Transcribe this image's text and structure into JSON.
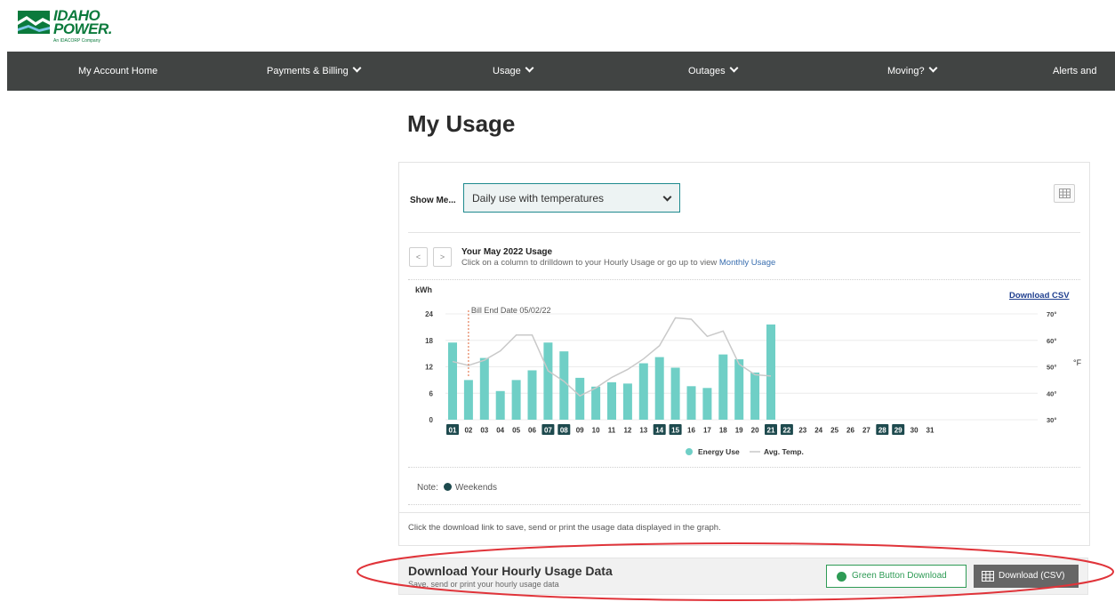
{
  "brand": {
    "name_line1": "IDAHO",
    "name_line2": "POWER.",
    "tagline": "An IDACORP Company"
  },
  "nav": [
    {
      "label": "My Account Home",
      "dropdown": false
    },
    {
      "label": "Payments & Billing",
      "dropdown": true
    },
    {
      "label": "Usage",
      "dropdown": true
    },
    {
      "label": "Outages",
      "dropdown": true
    },
    {
      "label": "Moving?",
      "dropdown": true
    },
    {
      "label": "Alerts and",
      "dropdown": false
    }
  ],
  "page": {
    "title": "My Usage"
  },
  "controls": {
    "show_me_label": "Show Me...",
    "selected_view": "Daily use with temperatures",
    "prev_label": "<",
    "next_label": ">"
  },
  "chart_header": {
    "title": "Your May 2022 Usage",
    "subtitle_prefix": "Click on a column to drilldown to your Hourly Usage or go up to view ",
    "subtitle_link": "Monthly Usage",
    "download_csv": "Download CSV"
  },
  "chart_data": {
    "type": "bar",
    "ylabel": "kWh",
    "y2label": "°F",
    "ylim": [
      0,
      24
    ],
    "y2lim": [
      30,
      70
    ],
    "yticks": [
      "0",
      "6",
      "12",
      "18",
      "24"
    ],
    "y2ticks": [
      "30°",
      "40°",
      "50°",
      "60°",
      "70°"
    ],
    "categories": [
      "01",
      "02",
      "03",
      "04",
      "05",
      "06",
      "07",
      "08",
      "09",
      "10",
      "11",
      "12",
      "13",
      "14",
      "15",
      "16",
      "17",
      "18",
      "19",
      "20",
      "21",
      "22",
      "23",
      "24",
      "25",
      "26",
      "27",
      "28",
      "29",
      "30",
      "31"
    ],
    "weekend_days": [
      "01",
      "07",
      "08",
      "14",
      "15",
      "21",
      "22",
      "28",
      "29"
    ],
    "series": [
      {
        "name": "Energy Use",
        "type": "bar",
        "color": "#6fcfc6",
        "values": [
          17.5,
          9,
          14,
          6.5,
          9,
          11.2,
          17.5,
          15.5,
          9.5,
          7.5,
          8.5,
          8.2,
          12.8,
          14.2,
          11.8,
          7.6,
          7.2,
          14.8,
          13.7,
          10.7,
          21.6,
          null,
          null,
          null,
          null,
          null,
          null,
          null,
          null,
          null,
          null
        ]
      },
      {
        "name": "Avg. Temp.",
        "type": "line",
        "color": "#c9c9c9",
        "values": [
          52,
          50.5,
          52.5,
          56,
          62,
          62,
          48.5,
          44.5,
          39,
          42,
          46,
          49,
          53,
          58,
          68.5,
          68,
          61.5,
          63.5,
          51,
          47,
          46.5,
          null,
          null,
          null,
          null,
          null,
          null,
          null,
          null,
          null,
          null
        ]
      }
    ],
    "annotation": {
      "label": "Bill End Date 05/02/22",
      "category": "02"
    },
    "legend": [
      "Energy Use",
      "Avg. Temp."
    ],
    "legend_position": "bottom"
  },
  "note": {
    "label": "Note:",
    "text": "Weekends"
  },
  "info_text": "Click the download link to save, send or print the usage data displayed in the graph.",
  "download": {
    "title": "Download Your Hourly Usage Data",
    "subtitle": "Save, send or print your hourly usage data",
    "green_button": "Green Button Download",
    "csv_button": "Download (CSV)"
  },
  "colors": {
    "nav_bg": "#414443",
    "bar": "#6fcfc6",
    "weekend_badge": "#1e4a4e",
    "temp_line": "#c9c9c9",
    "highlight": "#e0343a",
    "green": "#2e9b55"
  }
}
